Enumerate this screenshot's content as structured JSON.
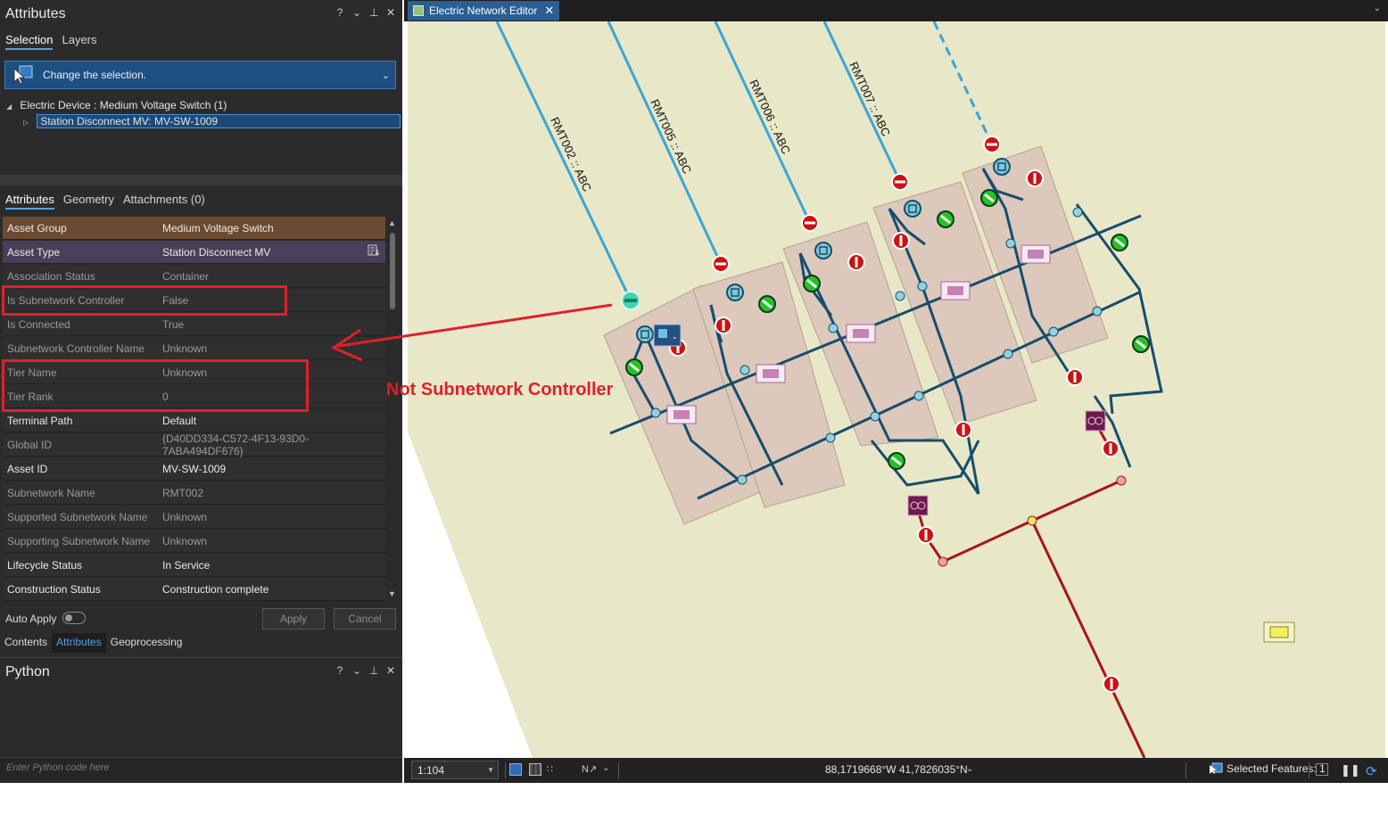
{
  "attributes_pane": {
    "title": "Attributes",
    "controls": [
      "?",
      "⌄",
      "⊥",
      "✕"
    ],
    "tabs": [
      "Selection",
      "Layers"
    ],
    "selection_dropdown": "Change the selection.",
    "tree": {
      "group": "Electric Device : Medium Voltage Switch (1)",
      "item": "Station Disconnect MV: MV-SW-1009"
    },
    "sub_tabs": [
      "Attributes",
      "Geometry",
      "Attachments (0)"
    ],
    "rows": [
      {
        "key": "Asset Group",
        "value": "Medium Voltage Switch"
      },
      {
        "key": "Asset Type",
        "value": "Station Disconnect MV"
      },
      {
        "key": "Association Status",
        "value": "Container"
      },
      {
        "key": "Is Subnetwork Controller",
        "value": "False"
      },
      {
        "key": "Is Connected",
        "value": "True"
      },
      {
        "key": "Subnetwork Controller Name",
        "value": "Unknown"
      },
      {
        "key": "Tier Name",
        "value": "Unknown"
      },
      {
        "key": "Tier Rank",
        "value": "0"
      },
      {
        "key": "Terminal Path",
        "value": "Default"
      },
      {
        "key": "Global ID",
        "value": "{D40DD334-C572-4F13-93D0-7ABA494DF676}"
      },
      {
        "key": "Asset ID",
        "value": "MV-SW-1009"
      },
      {
        "key": "Subnetwork Name",
        "value": "RMT002"
      },
      {
        "key": "Supported Subnetwork Name",
        "value": "Unknown"
      },
      {
        "key": "Supporting Subnetwork Name",
        "value": "Unknown"
      },
      {
        "key": "Lifecycle Status",
        "value": "In Service"
      },
      {
        "key": "Construction Status",
        "value": "Construction complete"
      }
    ],
    "auto_apply": "Auto Apply",
    "apply": "Apply",
    "cancel": "Cancel"
  },
  "dock_tabs": [
    "Contents",
    "Attributes",
    "Geoprocessing"
  ],
  "python_pane": {
    "title": "Python",
    "controls": [
      "?",
      "⌄",
      "⊥",
      "✕"
    ],
    "placeholder": "Enter Python code here"
  },
  "map": {
    "tab_title": "Electric Network Editor",
    "line_labels": [
      "RMT002 :: ABC",
      "RMT005 :: ABC",
      "RMT006 :: ABC",
      "RMT007 :: ABC"
    ],
    "annotation": "Not Subnetwork Controller",
    "colors": {
      "background": "#e8e8c9",
      "feeder_line": "#3aa6d6",
      "bus": "#174d6b",
      "red_line": "#a81515",
      "annotation": "#e0202a"
    }
  },
  "status_bar": {
    "scale": "1:104",
    "coordinates": "88,1719668°W 41,7826035°N",
    "selected_features": "Selected Features: 1"
  }
}
